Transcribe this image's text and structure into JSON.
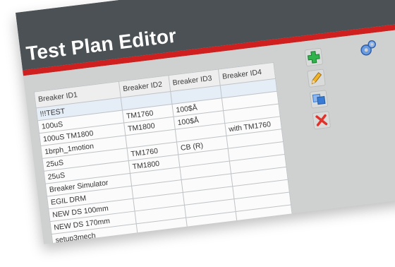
{
  "window": {
    "title": "Test Plan Editor"
  },
  "table": {
    "columns": [
      "Breaker ID1",
      "Breaker ID2",
      "Breaker ID3",
      "Breaker ID4"
    ],
    "rows": [
      [
        "!!!TEST",
        "",
        "",
        ""
      ],
      [
        "100uS",
        "TM1760",
        "100$Å",
        ""
      ],
      [
        "100uS TM1800",
        "TM1800",
        "100$Å",
        ""
      ],
      [
        "1brph_1motion",
        "",
        "",
        "with TM1760"
      ],
      [
        "25uS",
        "TM1760",
        "CB (R)",
        ""
      ],
      [
        "25uS",
        "TM1800",
        "",
        ""
      ],
      [
        "Breaker Simulator",
        "",
        "",
        ""
      ],
      [
        "EGIL DRM",
        "",
        "",
        ""
      ],
      [
        "NEW DS 100mm",
        "",
        "",
        ""
      ],
      [
        "NEW DS 170mm",
        "",
        "",
        ""
      ],
      [
        "setup3mech",
        "",
        "",
        ""
      ]
    ]
  },
  "toolbar": {
    "add": {
      "icon": "plus-icon",
      "color": "#2fb34a"
    },
    "edit": {
      "icon": "pencil-icon",
      "color": "#e0a020"
    },
    "copy": {
      "icon": "copy-icon",
      "color": "#3a7bd5"
    },
    "delete": {
      "icon": "x-icon",
      "color": "#e0322a"
    },
    "settings": {
      "icon": "gears-icon",
      "color": "#5a8fd8"
    }
  },
  "colors": {
    "header": "#4b5154",
    "accent": "#cf1f1f"
  }
}
